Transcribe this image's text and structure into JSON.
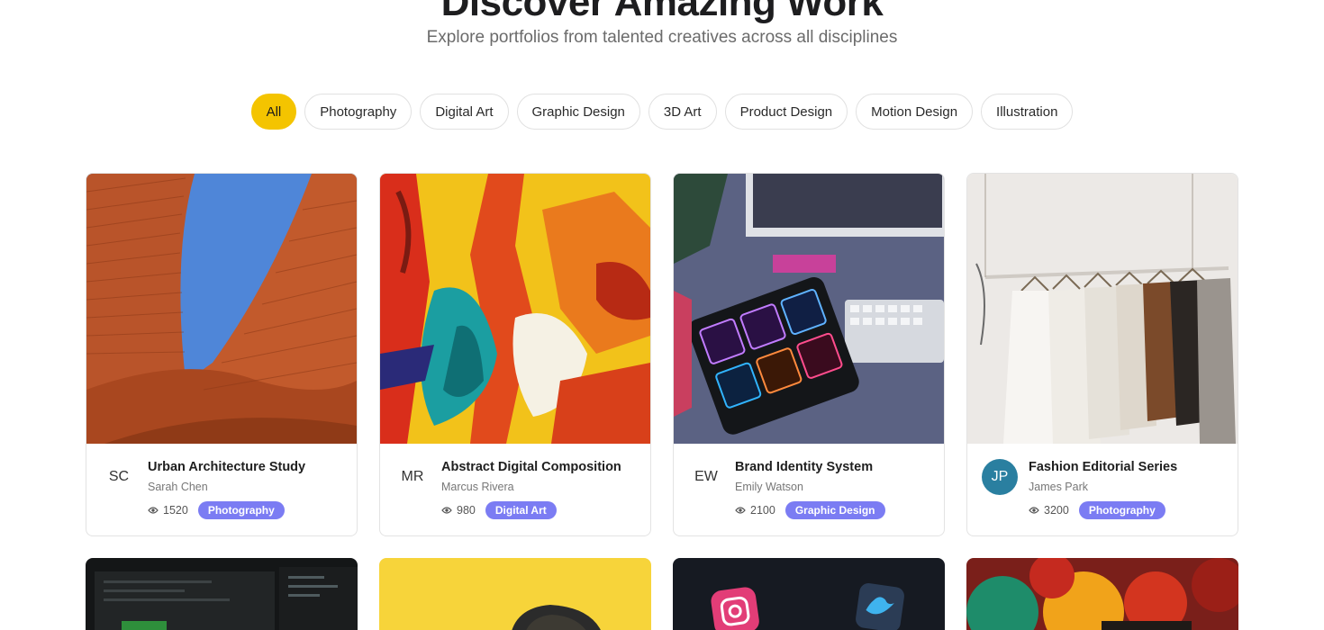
{
  "hero": {
    "title": "Discover Amazing Work",
    "subtitle": "Explore portfolios from talented creatives across all disciplines"
  },
  "filters": [
    {
      "label": "All",
      "active": true
    },
    {
      "label": "Photography",
      "active": false
    },
    {
      "label": "Digital Art",
      "active": false
    },
    {
      "label": "Graphic Design",
      "active": false
    },
    {
      "label": "3D Art",
      "active": false
    },
    {
      "label": "Product Design",
      "active": false
    },
    {
      "label": "Motion Design",
      "active": false
    },
    {
      "label": "Illustration",
      "active": false
    }
  ],
  "projects": [
    {
      "title": "Urban Architecture Study",
      "author": "Sarah Chen",
      "initials": "SC",
      "views": "1520",
      "category": "Photography",
      "avatar_filled": false
    },
    {
      "title": "Abstract Digital Composition",
      "author": "Marcus Rivera",
      "initials": "MR",
      "views": "980",
      "category": "Digital Art",
      "avatar_filled": false
    },
    {
      "title": "Brand Identity System",
      "author": "Emily Watson",
      "initials": "EW",
      "views": "2100",
      "category": "Graphic Design",
      "avatar_filled": false
    },
    {
      "title": "Fashion Editorial Series",
      "author": "James Park",
      "initials": "JP",
      "views": "3200",
      "category": "Photography",
      "avatar_filled": true
    }
  ],
  "colors": {
    "accent": "#f4c400",
    "badge": "#7b7cf3",
    "avatar_fill": "#2a7fa0"
  },
  "icons": {
    "views": "eye-icon"
  }
}
